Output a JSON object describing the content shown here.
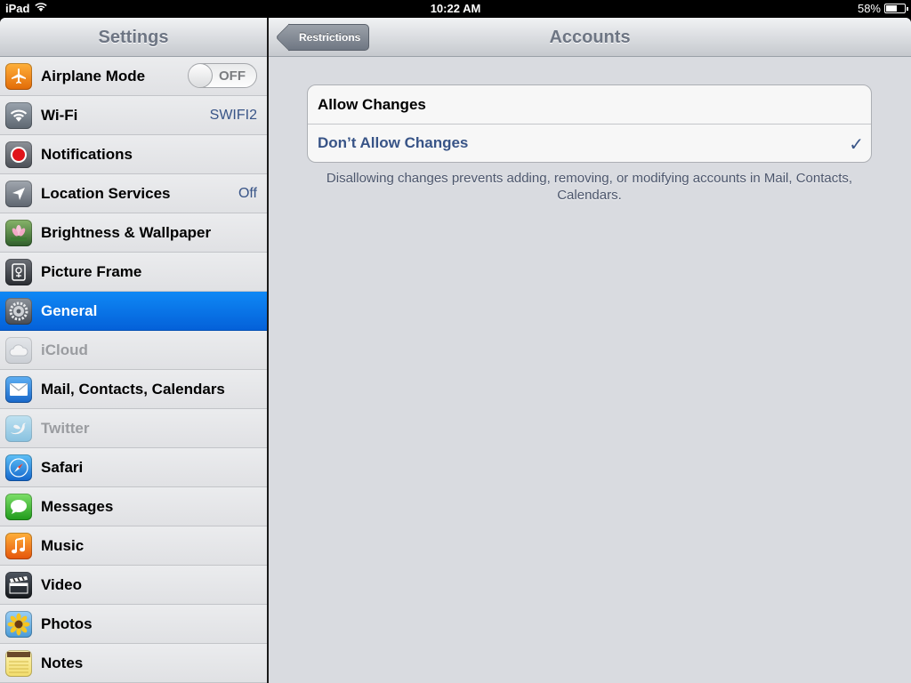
{
  "status_bar": {
    "device": "iPad",
    "time": "10:22 AM",
    "battery": "58%",
    "battery_level": 0.58
  },
  "sidebar": {
    "title": "Settings",
    "items": [
      {
        "label": "Airplane Mode",
        "icon": "airplane-icon",
        "toggle": "OFF"
      },
      {
        "label": "Wi-Fi",
        "icon": "wifi-icon",
        "value": "SWIFI2"
      },
      {
        "label": "Notifications",
        "icon": "notifications-icon"
      },
      {
        "label": "Location Services",
        "icon": "location-icon",
        "value": "Off"
      },
      {
        "label": "Brightness & Wallpaper",
        "icon": "brightness-wallpaper-icon"
      },
      {
        "label": "Picture Frame",
        "icon": "picture-frame-icon"
      },
      {
        "label": "General",
        "icon": "gear-icon",
        "selected": true
      },
      {
        "label": "iCloud",
        "icon": "cloud-icon",
        "disabled": true
      },
      {
        "label": "Mail, Contacts, Calendars",
        "icon": "mail-icon"
      },
      {
        "label": "Twitter",
        "icon": "twitter-bird-icon",
        "disabled": true
      },
      {
        "label": "Safari",
        "icon": "compass-icon"
      },
      {
        "label": "Messages",
        "icon": "speech-bubble-icon"
      },
      {
        "label": "Music",
        "icon": "music-note-icon"
      },
      {
        "label": "Video",
        "icon": "clapperboard-icon"
      },
      {
        "label": "Photos",
        "icon": "sunflower-icon"
      },
      {
        "label": "Notes",
        "icon": "notepad-icon"
      }
    ]
  },
  "detail": {
    "back_label": "Restrictions",
    "title": "Accounts",
    "options": [
      {
        "label": "Allow Changes",
        "checked": false
      },
      {
        "label": "Don’t Allow Changes",
        "checked": true
      }
    ],
    "checkmark": "✓",
    "footnote": "Disallowing changes prevents adding, removing, or modifying accounts in Mail, Contacts, Calendars."
  },
  "colors": {
    "selection_blue": "#0a72e8",
    "value_blue": "#385487",
    "header_text": "#6d7583"
  }
}
